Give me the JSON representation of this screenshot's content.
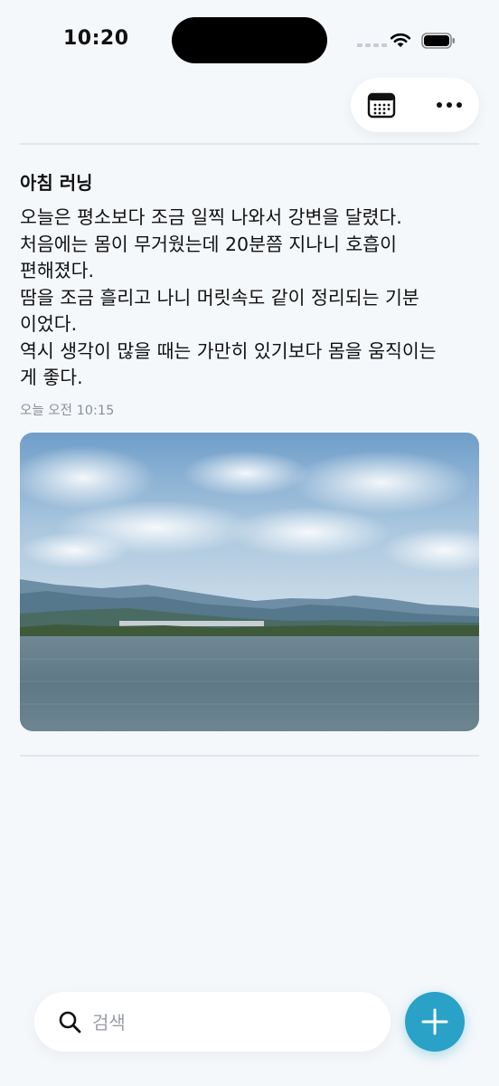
{
  "status_bar": {
    "time": "10:20"
  },
  "toolbar": {
    "calendar_icon": "calendar-icon",
    "more_icon": "more-horizontal-icon"
  },
  "entry": {
    "title": "아침 러닝",
    "body_lines": [
      "오늘은 평소보다 조금 일찍 나와서 강변을 달렸다.",
      "처음에는 몸이 무거웠는데 20분쯤 지나니 호흡이",
      "편해졌다.",
      "땀을 조금 흘리고 나니 머릿속도 같이 정리되는 기분",
      "이었다.",
      "역시 생각이 많을 때는 가만히 있기보다 몸을 움직이는",
      "게 좋다."
    ],
    "timestamp": "오늘 오전 10:15",
    "photo_icon": "river-landscape-photo"
  },
  "search": {
    "placeholder": "검색",
    "value": ""
  },
  "fab": {
    "icon": "plus-icon"
  },
  "colors": {
    "background": "#f5f8fb",
    "accent": "#2aa1c7",
    "divider": "#e2e6ea",
    "muted_text": "#8a9097"
  }
}
